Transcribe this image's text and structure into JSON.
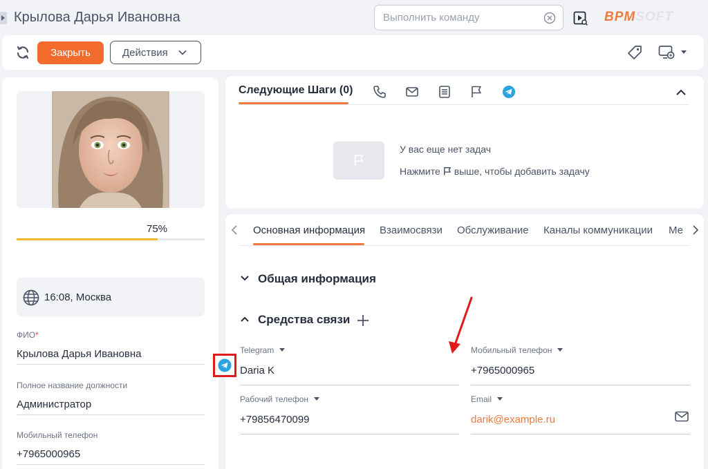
{
  "header": {
    "title": "Крылова Дарья Ивановна",
    "command_placeholder": "Выполнить команду",
    "logo_part1": "BPM",
    "logo_part2": "SOFT"
  },
  "toolbar": {
    "close_label": "Закрыть",
    "actions_label": "Действия"
  },
  "profile": {
    "completeness": 75,
    "completeness_label": "75%",
    "time_label": "16:08, Москва",
    "fields": [
      {
        "label": "ФИО",
        "required_mark": "*",
        "value": "Крылова Дарья Ивановна"
      },
      {
        "label": "Полное название должности",
        "value": "Администратор"
      },
      {
        "label": "Мобильный телефон",
        "value": "+7965000965"
      }
    ]
  },
  "next_steps": {
    "title": "Следующие Шаги (0)",
    "empty_line1": "У вас еще нет задач",
    "empty_line2_before": "Нажмите",
    "empty_line2_after": "выше, чтобы добавить задачу",
    "icons": [
      "phone-icon",
      "email-icon",
      "document-icon",
      "flag-icon",
      "telegram-icon"
    ]
  },
  "tabs": [
    "Основная информация",
    "Взаимосвязи",
    "Обслуживание",
    "Каналы коммуникации",
    "Ме"
  ],
  "groups": {
    "general": "Общая информация",
    "communication": "Средства связи"
  },
  "comm_fields": [
    {
      "label": "Telegram",
      "value": "Daria K"
    },
    {
      "label": "Мобильный телефон",
      "value": "+7965000965"
    },
    {
      "label": "Рабочий телефон",
      "value": "+79856470099"
    },
    {
      "label": "Email",
      "value": "darik@example.ru"
    }
  ],
  "colors": {
    "accent": "#f26b2c",
    "progress": "#f5b82e",
    "telegram": "#2aa3e0",
    "highlight": "#e01b1b"
  }
}
